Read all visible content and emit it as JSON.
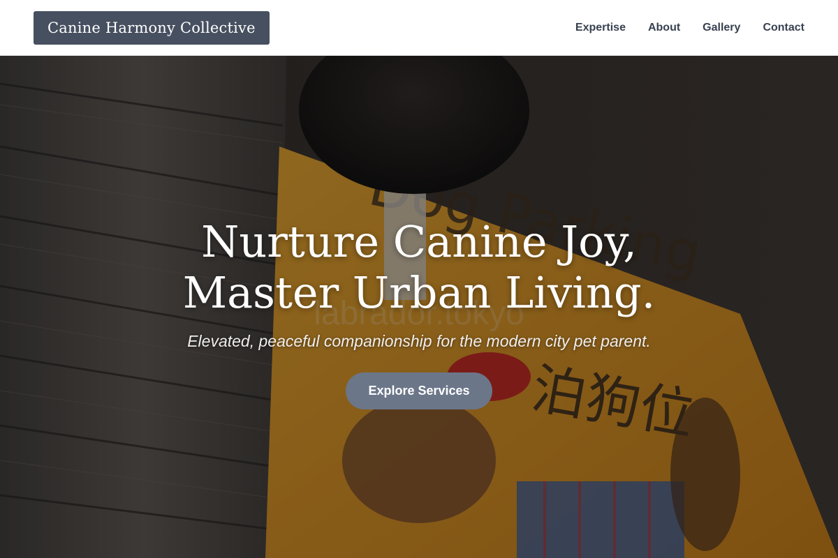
{
  "header": {
    "logo_text": "Canine Harmony Collective",
    "nav": [
      "Expertise",
      "About",
      "Gallery",
      "Contact"
    ]
  },
  "hero": {
    "title_line1": "Nurture Canine Joy,",
    "title_line2": "Master Urban Living.",
    "subtitle": "Elevated, peaceful companionship for the modern city pet parent.",
    "cta_label": "Explore Services",
    "watermark": "labrador.tokyo",
    "sign_text": [
      "Dog Parking",
      "泊狗位"
    ]
  },
  "colors": {
    "logo_bg": "#475060",
    "cta_bg": "#6b7689",
    "nav_text": "#374151"
  }
}
